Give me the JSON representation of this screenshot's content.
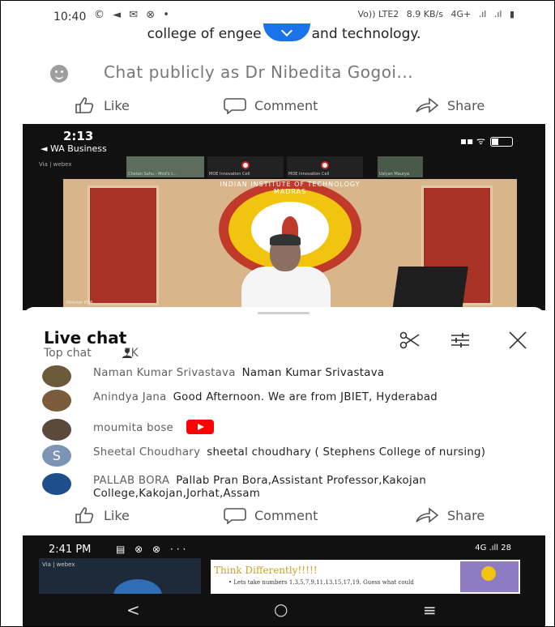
{
  "status_bar": {
    "time": "10:40",
    "icons": "© ◄ ✉ ⊗ •",
    "network_right": [
      "Vo)) LTE2",
      "8.9 KB/s",
      "4G+",
      ".ıl",
      ".ıl",
      "▮"
    ]
  },
  "post": {
    "title_left": "college of engee",
    "title_right": "and technology.",
    "chat_placeholder": "Chat publicly as Dr Nibedita Gogoi..."
  },
  "actions": {
    "like": "Like",
    "comment": "Comment",
    "share": "Share"
  },
  "video": {
    "time": "2:13",
    "back_app": "◄ WA Business",
    "webex_label": "Via | webex",
    "thumbnails": [
      "Chetan Sahu - Mod's t...",
      "MOE Innovation Cell",
      "MOE Innovation Cell",
      "Uslyan Maurya"
    ],
    "crest_text": "INDIAN INSTITUTE OF TECHNOLOGY MADRAS",
    "speaker_tag": "Director IITM"
  },
  "live_chat": {
    "title": "Live chat",
    "subtitle": "Top chat",
    "viewer_count": "7K",
    "messages": [
      {
        "author": "Naman Kumar Srivastava",
        "text": "Naman Kumar Srivastava",
        "avatar_color": "#6d5a3a"
      },
      {
        "author": "Anindya Jana",
        "text": "Good Afternoon. We are from JBIET, Hyderabad",
        "avatar_color": "#7a5c3c"
      },
      {
        "author": "moumita bose",
        "text": "",
        "avatar_color": "#5b4a3a"
      },
      {
        "author": "Sheetal Choudhary",
        "text": "sheetal choudhary ( Stephens College of nursing)",
        "avatar_letter": "S",
        "avatar_color": "#7c95b5"
      },
      {
        "author": "PALLAB BORA",
        "text": "Pallab Pran Bora,Assistant Professor,Kakojan College,Kakojan,Jorhat,Assam",
        "avatar_color": "#1f4e8c"
      }
    ]
  },
  "video2": {
    "time": "2:41 PM",
    "icons": "▤ ⊗ ⊗ ···",
    "right": "4G .ıll 28",
    "webex_label": "Via | webex",
    "slide_title": "Think Differently!!!!!",
    "slide_bullet": "•  Lets take numbers 1,3,5,7,9,11,13,15,17,19. Guess what could"
  },
  "nav": {
    "back": "<",
    "home": "○",
    "menu": "≡"
  }
}
